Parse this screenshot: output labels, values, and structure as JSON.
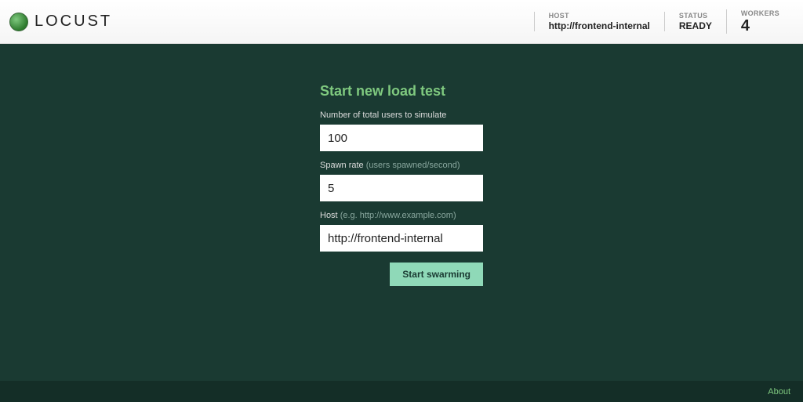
{
  "header": {
    "brand": "LOCUST",
    "stats": {
      "host_label": "HOST",
      "host_value": "http://frontend-internal",
      "status_label": "STATUS",
      "status_value": "READY",
      "workers_label": "WORKERS",
      "workers_value": "4"
    }
  },
  "form": {
    "title": "Start new load test",
    "users_label": "Number of total users to simulate",
    "users_value": "100",
    "spawn_label": "Spawn rate ",
    "spawn_hint": "(users spawned/second)",
    "spawn_value": "5",
    "host_label": "Host ",
    "host_hint": "(e.g. http://www.example.com)",
    "host_value": "http://frontend-internal",
    "submit_label": "Start swarming"
  },
  "footer": {
    "about": "About"
  }
}
